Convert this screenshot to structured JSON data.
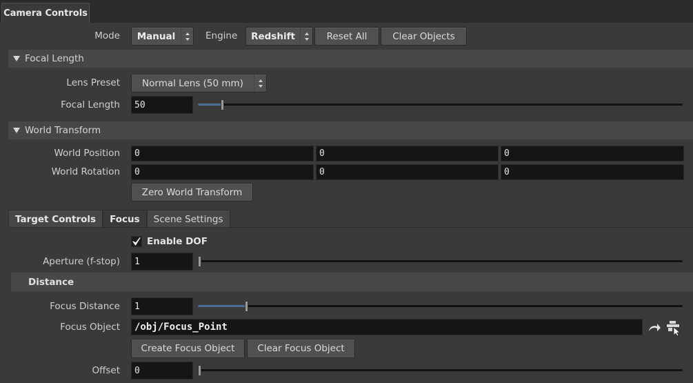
{
  "tabs": {
    "main": "Camera Controls"
  },
  "toolbar": {
    "mode_label": "Mode",
    "mode_value": "Manual",
    "engine_label": "Engine",
    "engine_value": "Redshift",
    "reset_all": "Reset All",
    "clear_objects": "Clear Objects"
  },
  "focal_length_section": {
    "title": "Focal Length",
    "lens_preset_label": "Lens Preset",
    "lens_preset_value": "Normal Lens (50 mm)",
    "focal_length_label": "Focal Length",
    "focal_length_value": "50",
    "focal_length_slider_fraction": 0.05
  },
  "world_transform_section": {
    "title": "World Transform",
    "position_label": "World Position",
    "position": [
      "0",
      "0",
      "0"
    ],
    "rotation_label": "World Rotation",
    "rotation": [
      "0",
      "0",
      "0"
    ],
    "zero_button": "Zero World Transform"
  },
  "lower_tabs": {
    "target_controls": "Target Controls",
    "focus": "Focus",
    "scene_settings": "Scene Settings"
  },
  "focus": {
    "enable_dof_label": "Enable DOF",
    "enable_dof_checked": true,
    "aperture_label": "Aperture (f-stop)",
    "aperture_value": "1",
    "aperture_slider_fraction": 0.0,
    "distance_section_title": "Distance",
    "focus_distance_label": "Focus Distance",
    "focus_distance_value": "1",
    "focus_distance_slider_fraction": 0.1,
    "focus_object_label": "Focus Object",
    "focus_object_value": "/obj/Focus_Point",
    "create_focus_object": "Create Focus Object",
    "clear_focus_object": "Clear Focus Object",
    "offset_label": "Offset",
    "offset_value": "0",
    "offset_slider_fraction": 0.0
  },
  "icons": {
    "jump": "jump-arrow-icon",
    "picker": "node-picker-icon",
    "collapse": "triangle-down-icon",
    "menu_arrows": "up-down-arrows-icon",
    "check": "checkmark-icon"
  },
  "colors": {
    "background": "#3a3a3a",
    "section": "#474747",
    "field": "#151515",
    "slider_fill": "#4a6f95"
  }
}
